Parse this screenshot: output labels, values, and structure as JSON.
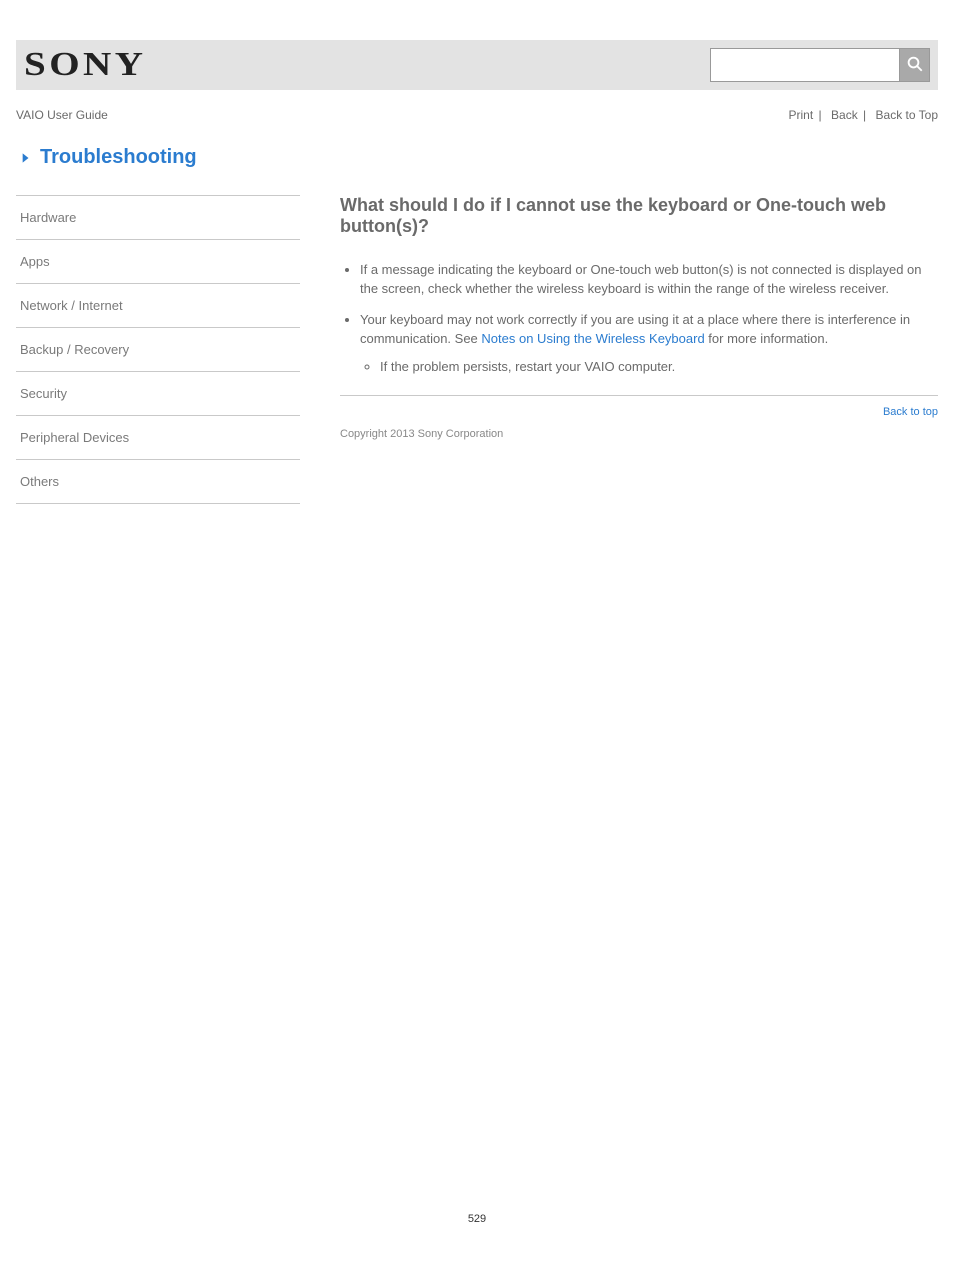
{
  "header": {
    "logo_text": "SONY",
    "search_value": "",
    "search_placeholder": ""
  },
  "toprow": {
    "model": "VAIO User Guide",
    "print_label": "Print",
    "back_label": "Back",
    "back_link": "Back to Top"
  },
  "blue_headline": "Troubleshooting",
  "nav": {
    "items": [
      "Hardware",
      "Apps",
      "Network / Internet",
      "Backup / Recovery",
      "Security",
      "Peripheral Devices",
      "Others"
    ]
  },
  "content": {
    "title": "What should I do if I cannot use the keyboard or One-touch web button(s)?",
    "bullets": [
      "If a message indicating the keyboard or One-touch web button(s) is not connected is displayed on the screen, check whether the wireless keyboard is within the range of the wireless receiver.",
      {
        "text_before": "Your keyboard may not work correctly if you are using it at a place where there is interference in communication. See ",
        "link_text": "Notes on Using the Wireless Keyboard",
        "text_after": " for more information.",
        "sub": "If the problem persists, restart your VAIO computer."
      }
    ]
  },
  "back_to_top": "Back to top",
  "copyright": "Copyright 2013 Sony Corporation",
  "page_number": "529"
}
